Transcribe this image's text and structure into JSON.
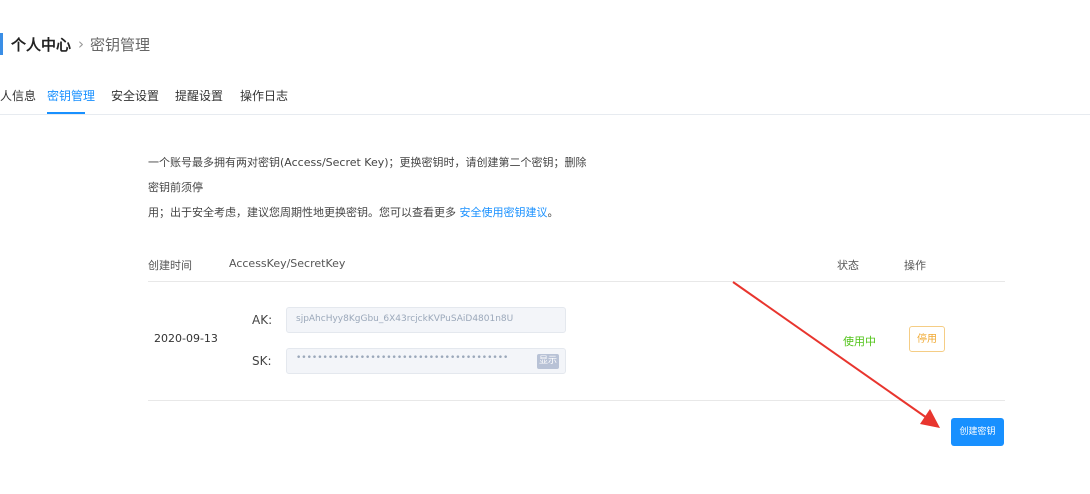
{
  "breadcrumb": {
    "current": "个人中心",
    "separator": "›",
    "page": "密钥管理"
  },
  "tabs": [
    {
      "label": "人信息",
      "active": false
    },
    {
      "label": "密钥管理",
      "active": true
    },
    {
      "label": "安全设置",
      "active": false
    },
    {
      "label": "提醒设置",
      "active": false
    },
    {
      "label": "操作日志",
      "active": false
    }
  ],
  "notice": {
    "line1": "一个账号最多拥有两对密钥(Access/Secret Key)；更换密钥时，请创建第二个密钥；删除密钥前须停",
    "line2": "用；出于安全考虑，建议您周期性地更换密钥。您可以查看更多 ",
    "link": "安全使用密钥建议",
    "tail": "。"
  },
  "table": {
    "headers": {
      "created": "创建时间",
      "keys": "AccessKey/SecretKey",
      "status": "状态",
      "action": "操作"
    },
    "rows": [
      {
        "created": "2020-09-13",
        "ak_label": "AK:",
        "ak_value": "sjpAhcHyy8KgGbu_6X43rcjckKVPuSAiD4801n8U",
        "sk_label": "SK:",
        "sk_value": "••••••••••••••••••••••••••••••••••••••••",
        "show_label": "显示",
        "status": "使用中",
        "action": "停用"
      }
    ]
  },
  "create_button": "创建密钥",
  "colors": {
    "accent": "#1890ff",
    "status_ok": "#52c41a",
    "warn": "#f0a830",
    "annotation_arrow": "#e8352e"
  }
}
